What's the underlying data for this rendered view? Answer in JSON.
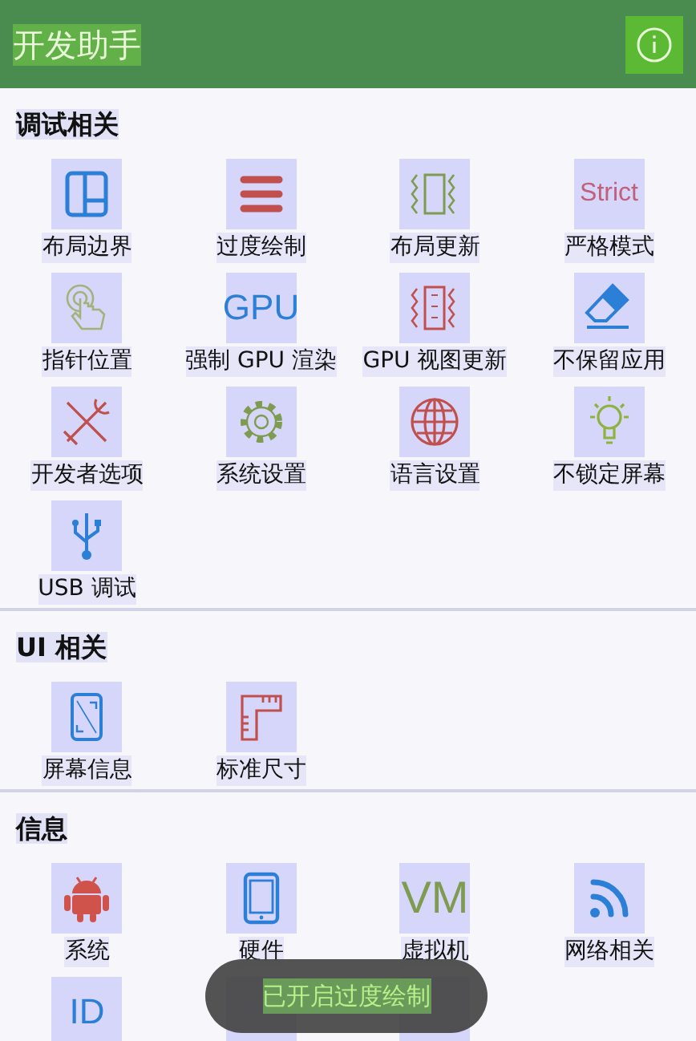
{
  "app_bar": {
    "title": "开发助手"
  },
  "sections": [
    {
      "heading": "调试相关",
      "items": [
        {
          "kind": "icon",
          "label": "布局边界"
        },
        {
          "kind": "icon",
          "label": "过度绘制"
        },
        {
          "kind": "icon",
          "label": "布局更新"
        },
        {
          "kind": "lettering",
          "icon_text": "Strict",
          "label": "严格模式"
        },
        {
          "kind": "icon",
          "label": "指针位置"
        },
        {
          "kind": "lettering",
          "icon_text": "GPU",
          "label": "强制 GPU 渲染"
        },
        {
          "kind": "icon",
          "label": "GPU 视图更新"
        },
        {
          "kind": "icon",
          "label": "不保留应用"
        },
        {
          "kind": "icon",
          "label": "开发者选项"
        },
        {
          "kind": "icon",
          "label": "系统设置"
        },
        {
          "kind": "icon",
          "label": "语言设置"
        },
        {
          "kind": "icon",
          "label": "不锁定屏幕"
        },
        {
          "kind": "icon",
          "label": "USB 调试"
        }
      ]
    },
    {
      "heading": "UI 相关",
      "items": [
        {
          "kind": "icon",
          "label": "屏幕信息"
        },
        {
          "kind": "icon",
          "label": "标准尺寸"
        }
      ]
    },
    {
      "heading": "信息",
      "items": [
        {
          "kind": "icon",
          "label": "系统"
        },
        {
          "kind": "icon",
          "label": "硬件"
        },
        {
          "kind": "lettering",
          "icon_text": "VM",
          "label": "虚拟机"
        },
        {
          "kind": "icon",
          "label": "网络相关"
        },
        {
          "kind": "lettering",
          "icon_text": "ID"
        },
        {
          "kind": "covered"
        },
        {
          "kind": "covered"
        }
      ]
    }
  ],
  "toast": {
    "text": "已开启过度绘制"
  }
}
